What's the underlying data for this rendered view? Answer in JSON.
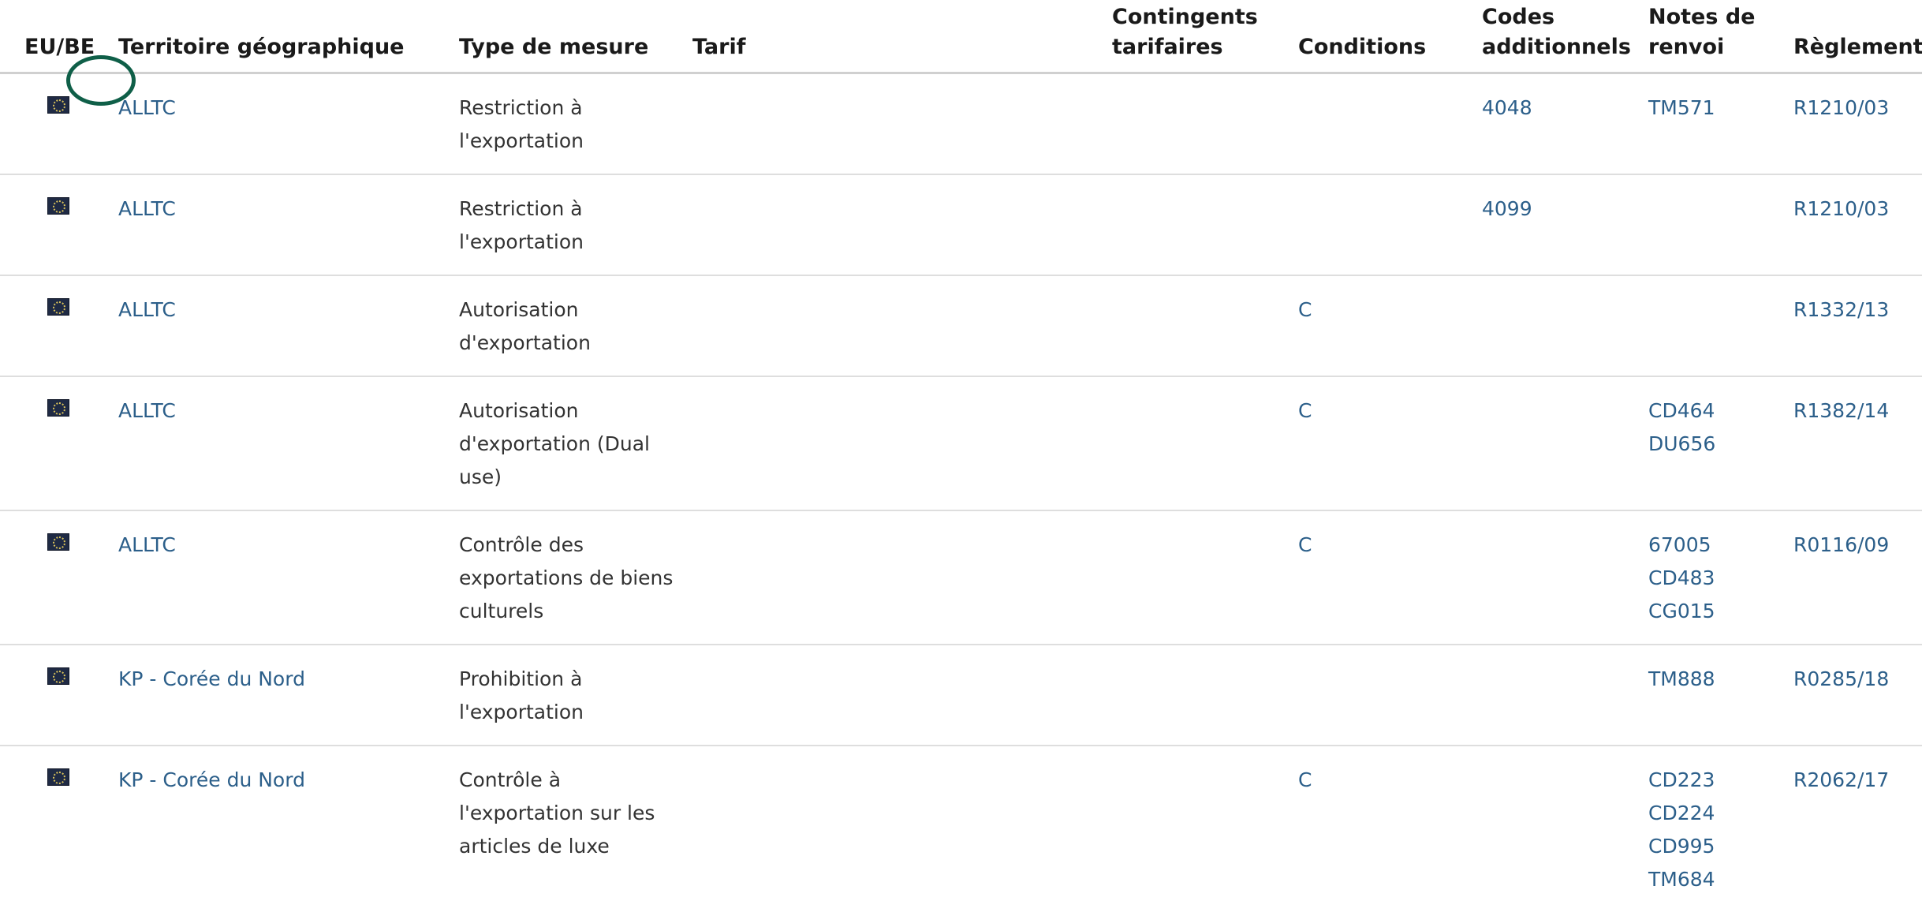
{
  "columns": {
    "eu_be": "EU/BE",
    "territory": "Territoire géographique",
    "measure_type": "Type de mesure",
    "tariff": "Tarif",
    "quotas_line1": "Contingents",
    "quotas_line2": "tarifaires",
    "conditions": "Conditions",
    "codes_line1": "Codes",
    "codes_line2": "additionnels",
    "notes_line1": "Notes de",
    "notes_line2": "renvoi",
    "regulation": "Règlement"
  },
  "rows": [
    {
      "flag_icon": "eu-flag-icon",
      "territory": "ALLTC",
      "measure_type": [
        "Restriction à",
        "l'exportation"
      ],
      "tariff": "",
      "quotas": "",
      "conditions": "",
      "additional_codes": [
        "4048"
      ],
      "footnotes": [
        "TM571"
      ],
      "regulation": "R1210/03"
    },
    {
      "flag_icon": "eu-flag-icon",
      "territory": "ALLTC",
      "measure_type": [
        "Restriction à",
        "l'exportation"
      ],
      "tariff": "",
      "quotas": "",
      "conditions": "",
      "additional_codes": [
        "4099"
      ],
      "footnotes": [],
      "regulation": "R1210/03"
    },
    {
      "flag_icon": "eu-flag-icon",
      "territory": "ALLTC",
      "measure_type": [
        "Autorisation",
        "d'exportation"
      ],
      "tariff": "",
      "quotas": "",
      "conditions": "C",
      "additional_codes": [],
      "footnotes": [],
      "regulation": "R1332/13"
    },
    {
      "flag_icon": "eu-flag-icon",
      "territory": "ALLTC",
      "measure_type": [
        "Autorisation",
        "d'exportation (Dual",
        "use)"
      ],
      "tariff": "",
      "quotas": "",
      "conditions": "C",
      "additional_codes": [],
      "footnotes": [
        "CD464",
        "DU656"
      ],
      "regulation": "R1382/14"
    },
    {
      "flag_icon": "eu-flag-icon",
      "territory": "ALLTC",
      "measure_type": [
        "Contrôle des",
        "exportations de biens",
        "culturels"
      ],
      "tariff": "",
      "quotas": "",
      "conditions": "C",
      "additional_codes": [],
      "footnotes": [
        "67005",
        "CD483",
        "CG015"
      ],
      "regulation": "R0116/09"
    },
    {
      "flag_icon": "eu-flag-icon",
      "territory": "KP - Corée du Nord",
      "measure_type": [
        "Prohibition à",
        "l'exportation"
      ],
      "tariff": "",
      "quotas": "",
      "conditions": "",
      "additional_codes": [],
      "footnotes": [
        "TM888"
      ],
      "regulation": "R0285/18"
    },
    {
      "flag_icon": "eu-flag-icon",
      "territory": "KP - Corée du Nord",
      "measure_type": [
        "Contrôle à",
        "l'exportation sur les",
        "articles de luxe"
      ],
      "tariff": "",
      "quotas": "",
      "conditions": "C",
      "additional_codes": [],
      "footnotes": [
        "CD223",
        "CD224",
        "CD995",
        "TM684"
      ],
      "regulation": "R2062/17"
    }
  ],
  "colors": {
    "link": "#2c5f8a",
    "text": "#333333",
    "header": "#1a1a1a",
    "highlight": "#0f5f48",
    "divider": "#dedede"
  }
}
